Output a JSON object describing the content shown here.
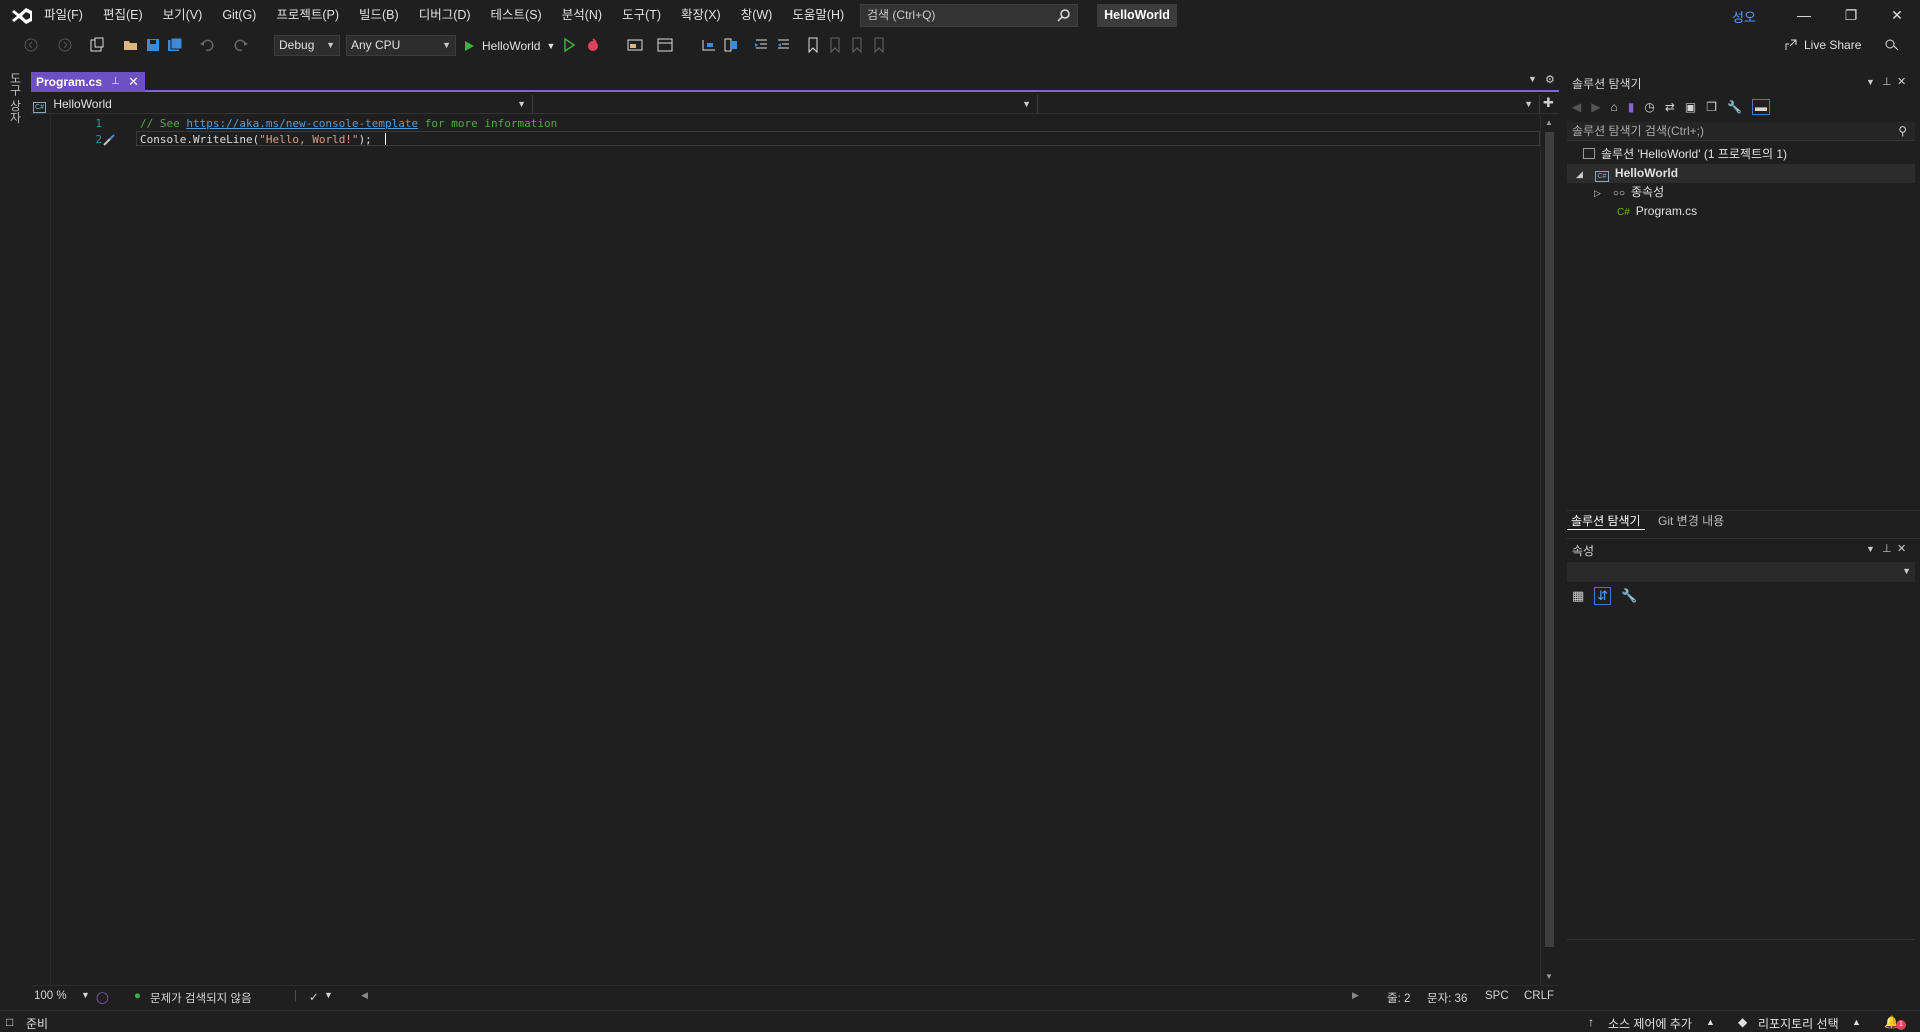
{
  "menubar": {
    "items": [
      "파일(F)",
      "편집(E)",
      "보기(V)",
      "Git(G)",
      "프로젝트(P)",
      "빌드(B)",
      "디버그(D)",
      "테스트(S)",
      "분석(N)",
      "도구(T)",
      "확장(X)",
      "창(W)",
      "도움말(H)"
    ],
    "search_placeholder": "검색 (Ctrl+Q)",
    "solution_name": "HelloWorld",
    "user_initials": "성오"
  },
  "toolbar": {
    "config": "Debug",
    "platform": "Any CPU",
    "run_target": "HelloWorld",
    "live_share": "Live Share"
  },
  "left_strip": {
    "label": "도구 상자"
  },
  "editor": {
    "tab_title": "Program.cs",
    "nav_project": "HelloWorld",
    "lines": [
      {
        "num": "1",
        "comment_prefix": "// See ",
        "link": "https://aka.ms/new-console-template",
        "comment_suffix": " for more information"
      },
      {
        "num": "2",
        "code_prefix": "Console.WriteLine(",
        "string": "\"Hello, World!\"",
        "code_suffix": ");"
      }
    ],
    "status": {
      "zoom": "100 %",
      "issues": "문제가 검색되지 않음",
      "line": "줄: 2",
      "char": "문자: 36",
      "spaces": "SPC",
      "line_ending": "CRLF"
    }
  },
  "solution_explorer": {
    "title": "솔루션 탐색기",
    "search_placeholder": "솔루션 탐색기 검색(Ctrl+;)",
    "solution_label": "솔루션 'HelloWorld' (1 프로젝트의 1)",
    "project": "HelloWorld",
    "dependencies": "종속성",
    "file_lang": "C#",
    "file": "Program.cs",
    "tabs": [
      "솔루션 탐색기",
      "Git 변경 내용"
    ]
  },
  "properties": {
    "title": "속성"
  },
  "statusbar": {
    "ready": "준비",
    "source_control": "소스 제어에 추가",
    "repository": "리포지토리 선택",
    "notification_count": "1"
  },
  "colors": {
    "accent_purple": "#6f4fc4",
    "comment_green": "#57a64a",
    "link_blue": "#569cd6",
    "string_brown": "#d69d85"
  }
}
